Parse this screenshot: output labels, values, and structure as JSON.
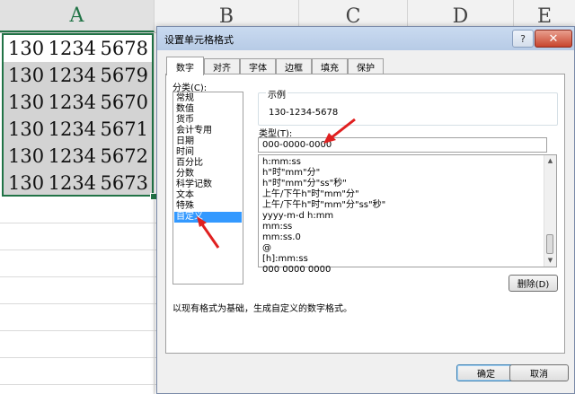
{
  "sheet": {
    "columns": [
      "A",
      "B",
      "C",
      "D",
      "E"
    ],
    "rows": [
      [
        "130",
        "1234",
        "5678"
      ],
      [
        "130",
        "1234",
        "5679"
      ],
      [
        "130",
        "1234",
        "5670"
      ],
      [
        "130",
        "1234",
        "5671"
      ],
      [
        "130",
        "1234",
        "5672"
      ],
      [
        "130",
        "1234",
        "5673"
      ]
    ]
  },
  "dialog": {
    "title": "设置单元格格式",
    "help": "?",
    "close": "✕",
    "tabs": [
      "数字",
      "对齐",
      "字体",
      "边框",
      "填充",
      "保护"
    ],
    "category_label": "分类(C):",
    "categories": [
      "常规",
      "数值",
      "货币",
      "会计专用",
      "日期",
      "时间",
      "百分比",
      "分数",
      "科学记数",
      "文本",
      "特殊",
      "自定义"
    ],
    "selected_category": "自定义",
    "sample_label": "示例",
    "sample_value": "130-1234-5678",
    "type_label": "类型(T):",
    "type_value": "000-0000-0000",
    "formats": [
      "h:mm:ss",
      "h\"时\"mm\"分\"",
      "h\"时\"mm\"分\"ss\"秒\"",
      "上午/下午h\"时\"mm\"分\"",
      "上午/下午h\"时\"mm\"分\"ss\"秒\"",
      "yyyy-m-d h:mm",
      "mm:ss",
      "mm:ss.0",
      "@",
      "[h]:mm:ss",
      "000 0000 0000"
    ],
    "delete_button": "删除(D)",
    "description": "以现有格式为基础，生成自定义的数字格式。",
    "ok_button": "确定",
    "cancel_button": "取消"
  },
  "colors": {
    "accent": "#217346",
    "selection": "#3399ff",
    "annotation_arrow": "#e02020"
  }
}
